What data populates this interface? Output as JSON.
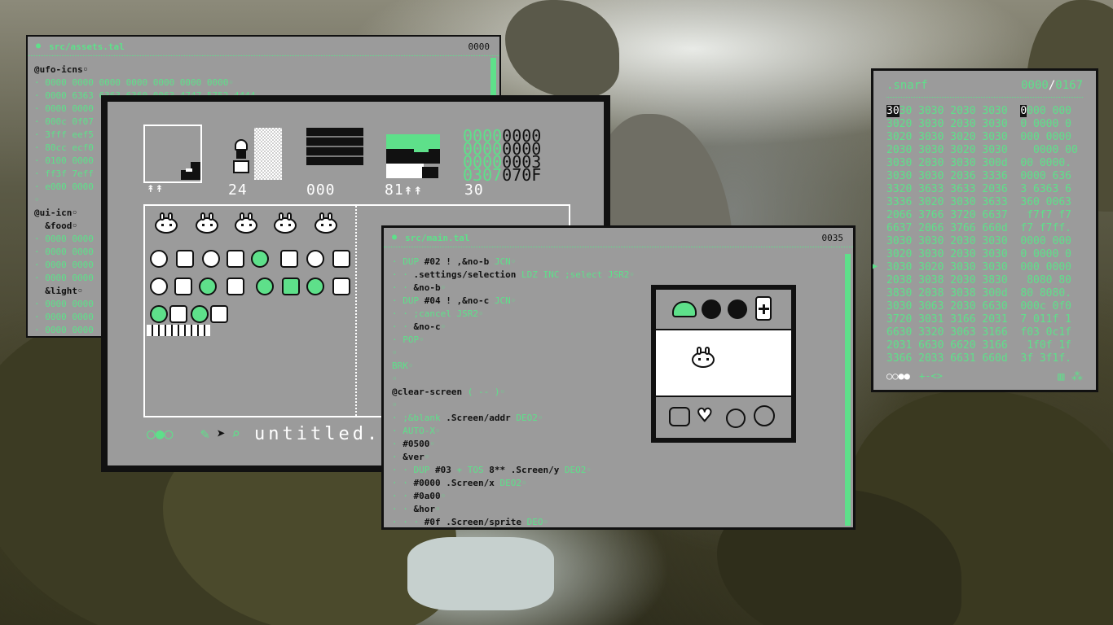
{
  "assets_window": {
    "title": "src/assets.tal",
    "counter": "0000",
    "lines": [
      {
        "cls": "k",
        "text": "@ufo-icns◦"
      },
      {
        "cls": "g",
        "text": "· 0000 0000 0000 0000 0000 0000 0000◦"
      },
      {
        "cls": "g",
        "text": "· 0000 6363 6363 6360 0063 4747 5752 4444"
      },
      {
        "cls": "g",
        "text": "· 0000 0000"
      },
      {
        "cls": "g",
        "text": "· 000c 0f07"
      },
      {
        "cls": "g",
        "text": "· 3fff eef5"
      },
      {
        "cls": "g",
        "text": "· 80cc ecf0"
      },
      {
        "cls": "g",
        "text": "· 0100 0000"
      },
      {
        "cls": "g",
        "text": "· ff3f 7eff"
      },
      {
        "cls": "g",
        "text": "· e000 0000"
      },
      {
        "cls": "g",
        "text": "◦"
      },
      {
        "cls": "k",
        "text": "@ui-icn◦"
      },
      {
        "cls": "k",
        "text": "  &food◦"
      },
      {
        "cls": "g",
        "text": "· 0000 0000"
      },
      {
        "cls": "g",
        "text": "· 0000 0000"
      },
      {
        "cls": "g",
        "text": "· 0000 0000"
      },
      {
        "cls": "g",
        "text": "· 0000 0000"
      },
      {
        "cls": "k",
        "text": "  &light◦"
      },
      {
        "cls": "g",
        "text": "· 0000 0000"
      },
      {
        "cls": "g",
        "text": "· 0000 0000"
      },
      {
        "cls": "g",
        "text": "· 0000 0000"
      }
    ]
  },
  "sprite_editor": {
    "labels": {
      "arrows1": "↟↟",
      "count1": "24",
      "count2": "000",
      "count3": "81↟↟",
      "count4": "30"
    },
    "hex_grid": [
      {
        "g": "0000",
        "k": "0000"
      },
      {
        "g": "0000",
        "k": "0000"
      },
      {
        "g": "0000",
        "k": "0003"
      },
      {
        "g": "0307",
        "k": "070F"
      }
    ],
    "footer": {
      "tools": "○●○",
      "filename": "untitled.c"
    }
  },
  "main_window": {
    "title": "src/main.tal",
    "counter": "0035",
    "lines": [
      [
        {
          "c": "g",
          "t": "· DUP "
        },
        {
          "c": "k",
          "t": "#02 ! ,&no-b"
        },
        {
          "c": "g",
          "t": " JCN◦"
        }
      ],
      [
        {
          "c": "g",
          "t": "· · "
        },
        {
          "c": "k",
          "t": ".settings/selection"
        },
        {
          "c": "g",
          "t": " LDZ INC ;select JSR2◦"
        }
      ],
      [
        {
          "c": "g",
          "t": "· · "
        },
        {
          "c": "k",
          "t": "&no-b"
        },
        {
          "c": "g",
          "t": "◦"
        }
      ],
      [
        {
          "c": "g",
          "t": "· DUP "
        },
        {
          "c": "k",
          "t": "#04 ! ,&no-c"
        },
        {
          "c": "g",
          "t": " JCN◦"
        }
      ],
      [
        {
          "c": "g",
          "t": "· · ;cancel JSR2◦"
        }
      ],
      [
        {
          "c": "g",
          "t": "· · "
        },
        {
          "c": "k",
          "t": "&no-c"
        },
        {
          "c": "g",
          "t": "◦"
        }
      ],
      [
        {
          "c": "g",
          "t": "· POP◦"
        }
      ],
      [
        {
          "c": "g",
          "t": "◦"
        }
      ],
      [
        {
          "c": "g",
          "t": "BRK◦"
        }
      ],
      [
        {
          "c": "g",
          "t": "◦"
        }
      ],
      [
        {
          "c": "k",
          "t": "@clear-screen"
        },
        {
          "c": "g",
          "t": " ( -- )◦"
        }
      ],
      [
        {
          "c": "g",
          "t": "◦"
        }
      ],
      [
        {
          "c": "g",
          "t": "· ;&blank "
        },
        {
          "c": "k",
          "t": ".Screen/addr"
        },
        {
          "c": "g",
          "t": " DEO2◦"
        }
      ],
      [
        {
          "c": "g",
          "t": "· AUTO-X◦"
        }
      ],
      [
        {
          "c": "g",
          "t": "· "
        },
        {
          "c": "k",
          "t": "#0500"
        },
        {
          "c": "g",
          "t": "◦"
        }
      ],
      [
        {
          "c": "g",
          "t": "· "
        },
        {
          "c": "k",
          "t": "&ver"
        },
        {
          "c": "g",
          "t": "◦"
        }
      ],
      [
        {
          "c": "g",
          "t": "· · DUP "
        },
        {
          "c": "k",
          "t": "#03"
        },
        {
          "c": "g",
          "t": " + TOS "
        },
        {
          "c": "k",
          "t": "8** .Screen/y"
        },
        {
          "c": "g",
          "t": " DEO2◦"
        }
      ],
      [
        {
          "c": "g",
          "t": "· · "
        },
        {
          "c": "k",
          "t": "#0000 .Screen/x"
        },
        {
          "c": "g",
          "t": " DEO2◦"
        }
      ],
      [
        {
          "c": "g",
          "t": "· · "
        },
        {
          "c": "k",
          "t": "#0a00"
        },
        {
          "c": "g",
          "t": "◦"
        }
      ],
      [
        {
          "c": "g",
          "t": "· · "
        },
        {
          "c": "k",
          "t": "&hor"
        },
        {
          "c": "g",
          "t": "◦"
        }
      ],
      [
        {
          "c": "g",
          "t": "· · · "
        },
        {
          "c": "k",
          "t": "#0f .Screen/sprite"
        },
        {
          "c": "g",
          "t": " DEO◦"
        }
      ]
    ]
  },
  "hex_window": {
    "title": ".snarf",
    "counter_a": "0000",
    "separator": "/",
    "counter_b": "0167",
    "rows": [
      {
        "sel": "30",
        "a": "30 3030 2030 3030",
        "sel2": "0",
        "b": "000 000"
      },
      {
        "sel": "",
        "a": "3020 3030 2030 3030",
        "sel2": "",
        "b": "0 0000 0"
      },
      {
        "sel": "",
        "a": "3020 3030 3020 3030",
        "sel2": "",
        "b": "000 0000"
      },
      {
        "sel": "",
        "a": "2030 3030 3020 3030",
        "sel2": "",
        "b": "  0000 00"
      },
      {
        "sel": "",
        "a": "3030 2030 3030 300d",
        "sel2": "",
        "b": "00 0000."
      },
      {
        "sel": "",
        "a": "3030 3030 2036 3336",
        "sel2": "",
        "b": "0000 636"
      },
      {
        "sel": "",
        "a": "3320 3633 3633 2036",
        "sel2": "",
        "b": "3 6363 6"
      },
      {
        "sel": "",
        "a": "3336 3020 3030 3633",
        "sel2": "",
        "b": "360 0063"
      },
      {
        "sel": "",
        "a": "2066 3766 3720 6637",
        "sel2": "",
        "b": " f7f7 f7"
      },
      {
        "sel": "",
        "a": "6637 2066 3766 660d",
        "sel2": "",
        "b": "f7 f7ff."
      },
      {
        "sel": "",
        "a": "3030 3030 2030 3030",
        "sel2": "",
        "b": "0000 000"
      },
      {
        "sel": "",
        "a": "3020 3030 2030 3030",
        "sel2": "",
        "b": "0 0000 0"
      },
      {
        "sel": "",
        "a": "3030 3020 3030 3030",
        "sel2": "",
        "b": "000 0000"
      },
      {
        "sel": "",
        "a": "2038 3038 2030 3830",
        "sel2": "",
        "b": " 8080 80"
      },
      {
        "sel": "",
        "a": "3830 2038 3038 300d",
        "sel2": "",
        "b": "80 8080."
      },
      {
        "sel": "",
        "a": "3030 3063 2030 6630",
        "sel2": "",
        "b": "000c 0f0"
      },
      {
        "sel": "",
        "a": "3720 3031 3166 2031",
        "sel2": "",
        "b": "7 011f 1"
      },
      {
        "sel": "",
        "a": "6630 3320 3063 3166",
        "sel2": "",
        "b": "f03 0c1f"
      },
      {
        "sel": "",
        "a": "2031 6630 6620 3166",
        "sel2": "",
        "b": " 1f0f 1f"
      },
      {
        "sel": "",
        "a": "3366 2033 6631 660d",
        "sel2": "",
        "b": "3f 3f1f."
      }
    ],
    "footer_left": "○○●●",
    "footer_mid": "+-<>",
    "footer_right": "▥ ⁂"
  },
  "colors": {
    "accent": "#5ee08a",
    "panel": "#9b9b9b",
    "ink": "#111111",
    "paper": "#ffffff"
  }
}
